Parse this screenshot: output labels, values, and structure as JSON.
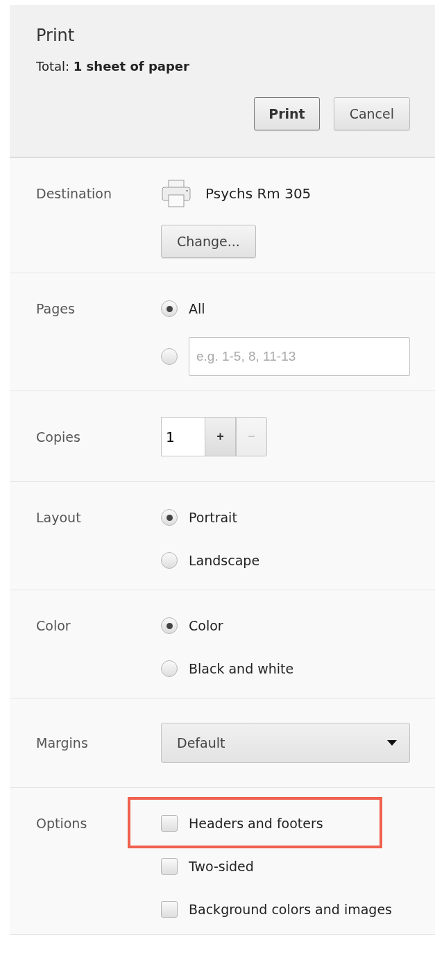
{
  "header": {
    "title": "Print",
    "total_label": "Total: **1 sheet of paper**",
    "buttons": [
      {
        "label": "Print",
        "default": true
      },
      {
        "label": "Cancel",
        "default": false
      }
    ]
  },
  "sections": [
    {
      "kind": "destination",
      "label": "Destination",
      "printer": "Psychs Rm 305",
      "button": "Change..."
    },
    {
      "kind": "radio",
      "label": "Pages",
      "options": [
        {
          "label": "All",
          "selected": true
        },
        {
          "placeholder": "e.g. 1-5, 8, 11-13",
          "selected": false
        }
      ]
    },
    {
      "kind": "copies",
      "label": "Copies",
      "value": "1",
      "increment": {
        "label": "+",
        "disabled": false
      },
      "decrement": {
        "label": "−",
        "disabled": true
      }
    },
    {
      "kind": "radio",
      "label": "Layout",
      "options": [
        {
          "label": "Portrait",
          "selected": true
        },
        {
          "label": "Landscape",
          "selected": false
        }
      ]
    },
    {
      "kind": "radio",
      "label": "Color",
      "options": [
        {
          "label": "Color",
          "selected": true
        },
        {
          "label": "Black and white",
          "selected": false
        }
      ]
    },
    {
      "kind": "select",
      "label": "Margins",
      "value": "Default"
    },
    {
      "kind": "checkbox",
      "label": "Options",
      "options": [
        {
          "label": "Headers and footers",
          "checked": false,
          "highlighted": true
        },
        {
          "label": "Two-sided",
          "checked": false,
          "highlighted": false
        },
        {
          "label": "Background colors and images",
          "checked": false,
          "highlighted": false
        }
      ]
    }
  ]
}
